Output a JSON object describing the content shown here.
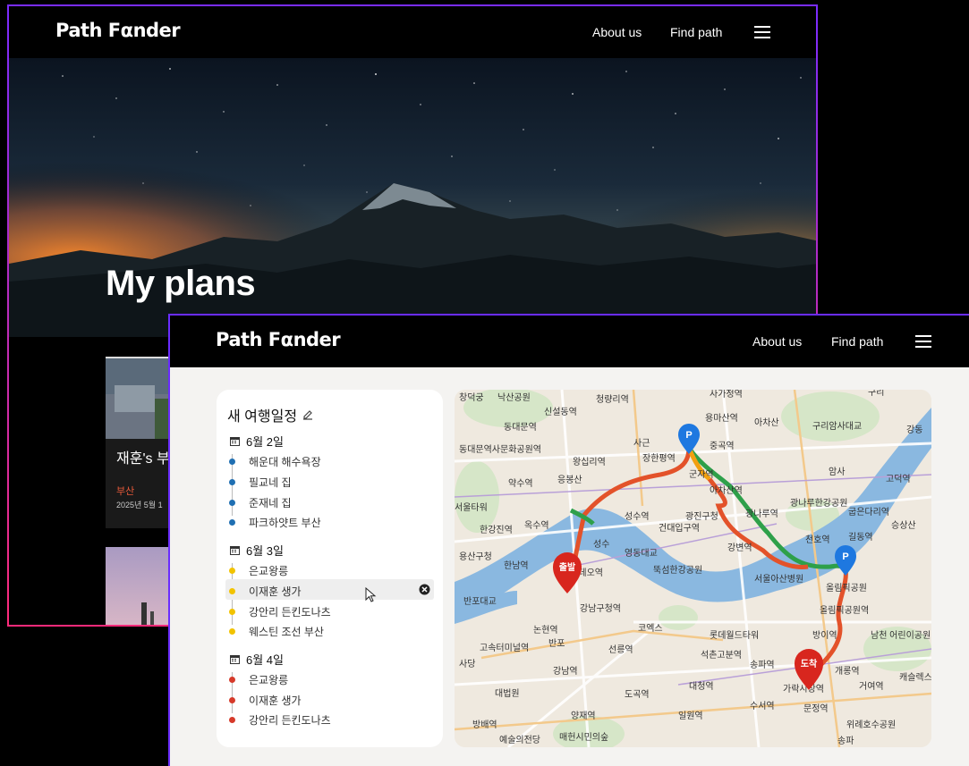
{
  "back_window": {
    "nav": {
      "logo": "Path Fαnder",
      "about": "About us",
      "find": "Find path"
    },
    "hero_title": "My plans",
    "card": {
      "title": "재훈's 부",
      "region": "부산",
      "date": "2025년 5월 1"
    }
  },
  "front_window": {
    "nav": {
      "logo": "Path Fαnder",
      "about": "About us",
      "find": "Find path"
    },
    "planner": {
      "title": "새 여행일정",
      "days": [
        {
          "label": "6월 2일",
          "color": "#1f6fb2",
          "items": [
            "해운대 해수욕장",
            "필교네 집",
            "준재네 집",
            "파크하얏트 부산"
          ]
        },
        {
          "label": "6월 3일",
          "color": "#f2c300",
          "items": [
            "은교왕릉",
            "이재훈 생가",
            "강안리 든킨도나츠",
            "웨스틴 조선 부산"
          ]
        },
        {
          "label": "6월 4일",
          "color": "#d63a2a",
          "items": [
            "은교왕릉",
            "이재훈 생가",
            "강안리 든킨도나츠"
          ]
        }
      ]
    },
    "map": {
      "markers": {
        "start": "출발",
        "end": "도착",
        "p": "P"
      },
      "labels": {
        "l1": "창덕궁",
        "l2": "낙산공원",
        "l3": "신설동역",
        "l4": "청량리역",
        "l5": "사가정역",
        "l6": "용마산역",
        "l7": "아차산",
        "l8": "구리암사대교",
        "l9": "광나루한강공원",
        "l10": "동대문역",
        "l11": "동대문역사문화공원역",
        "l12": "왕십리역",
        "l13": "장한평역",
        "l14": "군자역",
        "l15": "아차산역",
        "l16": "광나루역",
        "l17": "천호역",
        "l18": "굽은다리역",
        "l19": "길동역",
        "l20": "약수역",
        "l21": "응봉산",
        "l22": "서울타워",
        "l23": "옥수역",
        "l24": "성수역",
        "l25": "광진구청",
        "l26": "건대입구역",
        "l27": "강변역",
        "l28": "한강진역",
        "l29": "성수",
        "l30": "영동대교",
        "l31": "정로데오역",
        "l32": "뚝섬한강공원",
        "l33": "한남역",
        "l34": "서울아산병원",
        "l35": "올림픽공원",
        "l36": "강남구청역",
        "l37": "논현역",
        "l38": "반포",
        "l39": "코엑스",
        "l40": "롯데월드타워",
        "l41": "선릉역",
        "l42": "석촌고분역",
        "l43": "방이역",
        "l44": "고속터미널역",
        "l45": "강남역",
        "l46": "대청역",
        "l47": "송파역",
        "l48": "가락시장역",
        "l49": "개롱역",
        "l50": "거여역",
        "l51": "대법원",
        "l52": "도곡역",
        "l53": "수서역",
        "l54": "문정역",
        "l55": "양재역",
        "l56": "일원역",
        "l57": "방배역",
        "l58": "예술의전당",
        "l59": "매헌시민의숲",
        "l60": "송파",
        "l61": "위례호수공원",
        "l62": "남천 어린이공원",
        "l63": "캐슬렉스",
        "l64": "암사",
        "l65": "고덕역",
        "l66": "강동",
        "l67": "구리",
        "l68": "사근",
        "l69": "반포대교",
        "l70": "올림픽공원역",
        "l71": "승상산",
        "l72": "용산구청",
        "l73": "중곡역",
        "l74": "사당"
      }
    }
  }
}
